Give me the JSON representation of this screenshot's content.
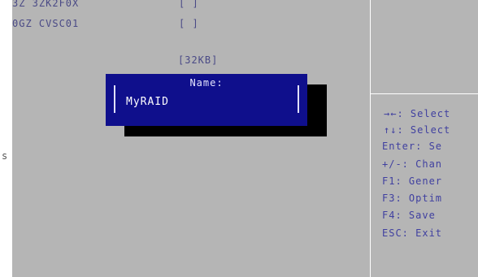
{
  "background_rows": {
    "row1_left": "3Z 3ZK2F0X",
    "row1_right": "[ ]",
    "row2_left": "0GZ CVSC01",
    "row2_right": "[ ]",
    "size": "[32KB]",
    "edge_glyph": "s"
  },
  "dialog": {
    "title": "Name:",
    "value": "MyRAID"
  },
  "help": {
    "items": [
      "→←: Select",
      "↑↓: Select",
      "Enter: Se",
      "+/-: Chan",
      "F1: Gener",
      "F3: Optim",
      "F4: Save ",
      "ESC: Exit"
    ]
  },
  "colors": {
    "panel": "#b5b5b5",
    "dialog": "#0f0f8c",
    "help_text": "#4040a0"
  }
}
